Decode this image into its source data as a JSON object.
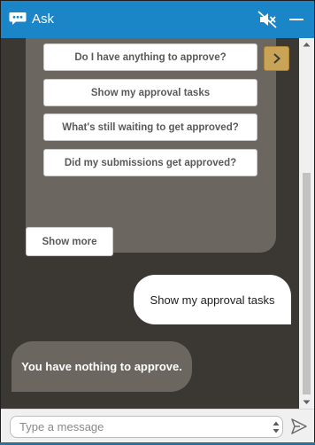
{
  "header": {
    "title": "Ask",
    "app_icon": "chat-bubble-icon",
    "mute_icon": "speaker-muted-icon",
    "minimize_icon": "minimize-icon",
    "color": "#1a86c8"
  },
  "suggestions": [
    "Do I have anything to approve?",
    "Show my approval tasks",
    "What's still waiting to get approved?",
    "Did my submissions get approved?"
  ],
  "next_button_icon": "chevron-right-icon",
  "show_more_label": "Show more",
  "messages": [
    {
      "from": "user",
      "text": "Show my approval tasks"
    },
    {
      "from": "bot",
      "text": "You have nothing to approve."
    }
  ],
  "composer": {
    "placeholder": "Type a message",
    "value": "",
    "send_icon": "send-icon"
  },
  "colors": {
    "chat_background": "#3b3733",
    "bot_bubble": "#6b6660",
    "accent_button": "#c9a456"
  }
}
